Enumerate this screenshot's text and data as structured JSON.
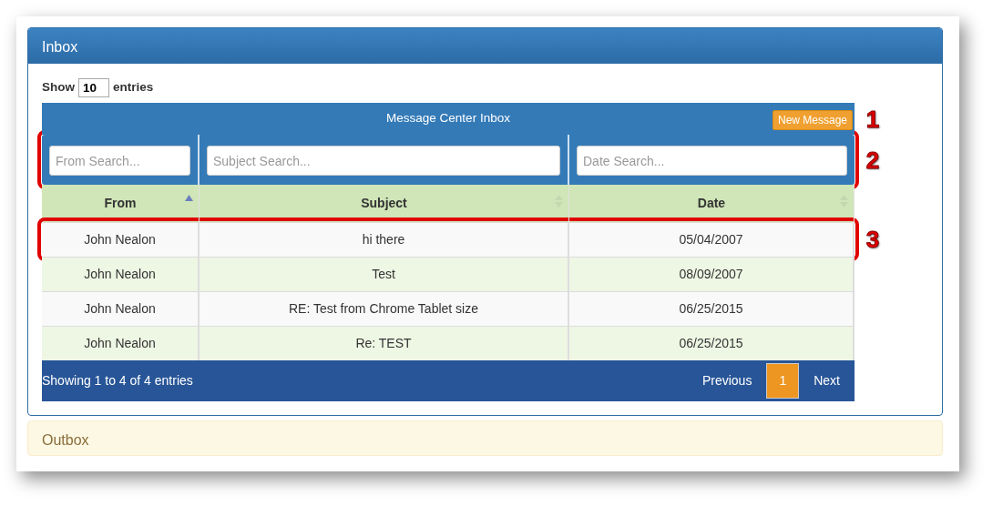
{
  "panel": {
    "title": "Inbox"
  },
  "length": {
    "label_before": "Show",
    "value": "10",
    "label_after": "entries"
  },
  "table": {
    "title": "Message Center Inbox",
    "new_button": "New Message",
    "title_callout": {
      "label": "1",
      "boxed": false
    },
    "filters_callout": {
      "label": "2",
      "boxed": true
    },
    "filters": [
      {
        "placeholder": "From Search..."
      },
      {
        "placeholder": "Subject Search..."
      },
      {
        "placeholder": "Date Search..."
      }
    ],
    "columns": [
      {
        "label": "From",
        "sorted_ascending": true
      },
      {
        "label": "Subject",
        "sorted_ascending": false
      },
      {
        "label": "Date",
        "sorted_ascending": false
      }
    ],
    "rows": [
      {
        "cells": [
          "John Nealon",
          "hi there",
          "05/04/2007"
        ],
        "callout": {
          "label": "3",
          "boxed": true
        }
      },
      {
        "cells": [
          "John Nealon",
          "Test",
          "08/09/2007"
        ]
      },
      {
        "cells": [
          "John Nealon",
          "RE: Test from Chrome Tablet size",
          "06/25/2015"
        ]
      },
      {
        "cells": [
          "John Nealon",
          "Re: TEST",
          "06/25/2015"
        ]
      }
    ],
    "info": "Showing 1 to 4 of 4 entries",
    "pagination": [
      {
        "label": "Previous",
        "selected": false
      },
      {
        "label": "1",
        "selected": true
      },
      {
        "label": "Next",
        "selected": false
      }
    ]
  },
  "outbox": {
    "title": "Outbox"
  }
}
